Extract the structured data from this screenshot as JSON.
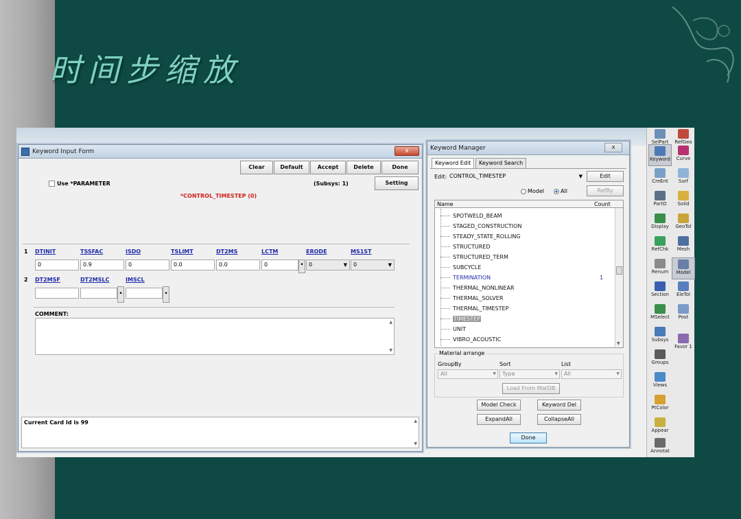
{
  "slide": {
    "title": "时间步缩放"
  },
  "keyword_input_form": {
    "title": "Keyword Input Form",
    "close_label": "x",
    "buttons": {
      "clear": "Clear",
      "default": "Default",
      "accept": "Accept",
      "delete": "Delete",
      "done": "Done",
      "setting": "Setting"
    },
    "use_parameter_label": "Use *PARAMETER",
    "subsys_label": "(Subsys: 1)",
    "keyword_heading": "*CONTROL_TIMESTEP  (0)",
    "card1": {
      "number": "1",
      "fields": [
        {
          "name": "DTINIT",
          "value": "0"
        },
        {
          "name": "TSSFAC",
          "value": "0.9"
        },
        {
          "name": "ISDO",
          "value": "0"
        },
        {
          "name": "TSLIMT",
          "value": "0.0"
        },
        {
          "name": "DT2MS",
          "value": "0.0"
        },
        {
          "name": "LCTM",
          "value": "0"
        },
        {
          "name": "ERODE",
          "value": "0"
        },
        {
          "name": "MS1ST",
          "value": "0"
        }
      ]
    },
    "card2": {
      "number": "2",
      "fields": [
        {
          "name": "DT2MSF",
          "value": ""
        },
        {
          "name": "DT2MSLC",
          "value": ""
        },
        {
          "name": "IMSCL",
          "value": ""
        }
      ]
    },
    "comment_label": "COMMENT:",
    "status_text": "Current Card Id is 99"
  },
  "keyword_manager": {
    "title": "Keyword Manager",
    "close_label": "x",
    "tabs": [
      "Keyword Edit",
      "Keyword Search"
    ],
    "edit_label": "Edit:",
    "edit_value": "CONTROL_TIMESTEP",
    "edit_button": "Edit",
    "refby_button": "RefBy",
    "radio_model": "Model",
    "radio_all": "All",
    "col_name": "Name",
    "col_count": "Count",
    "items": [
      {
        "name": "SPOTWELD_BEAM",
        "count": ""
      },
      {
        "name": "STAGED_CONSTRUCTION",
        "count": ""
      },
      {
        "name": "STEADY_STATE_ROLLING",
        "count": ""
      },
      {
        "name": "STRUCTURED",
        "count": ""
      },
      {
        "name": "STRUCTURED_TERM",
        "count": ""
      },
      {
        "name": "SUBCYCLE",
        "count": ""
      },
      {
        "name": "TERMINATION",
        "count": "1"
      },
      {
        "name": "THERMAL_NONLINEAR",
        "count": ""
      },
      {
        "name": "THERMAL_SOLVER",
        "count": ""
      },
      {
        "name": "THERMAL_TIMESTEP",
        "count": ""
      },
      {
        "name": "TIMESTEP",
        "count": ""
      },
      {
        "name": "UNIT",
        "count": ""
      },
      {
        "name": "VIBRO_ACOUSTIC",
        "count": ""
      }
    ],
    "material_arrange": "Material arrange",
    "groupby_label": "GroupBy",
    "sort_label": "Sort",
    "list_label": "List",
    "groupby_value": "All",
    "sort_value": "Type",
    "list_value": "All",
    "load_button": "Load From MatDB",
    "model_check": "Model Check",
    "keyword_del": "Keyword Del",
    "expand_all": "ExpandAll",
    "collapse_all": "CollapseAll",
    "done": "Done"
  },
  "toolbar": {
    "items": [
      {
        "label": "SelPart",
        "color": "#6d8fb8"
      },
      {
        "label": "RefGeo",
        "color": "#c04a3a"
      },
      {
        "label": "Keyword",
        "color": "#4d79b5"
      },
      {
        "label": "Curve",
        "color": "#b83070"
      },
      {
        "label": "CreEnt",
        "color": "#7aa0c8"
      },
      {
        "label": "Surf",
        "color": "#8fb3d9"
      },
      {
        "label": "PartD",
        "color": "#5c6f88"
      },
      {
        "label": "Solid",
        "color": "#d8b040"
      },
      {
        "label": "Display",
        "color": "#3a8f4a"
      },
      {
        "label": "GeoTol",
        "color": "#c9a43a"
      },
      {
        "label": "RefChk",
        "color": "#3aa05a"
      },
      {
        "label": "Mesh",
        "color": "#4f6fa0"
      },
      {
        "label": "Renum",
        "color": "#8a8a8a"
      },
      {
        "label": "Model",
        "color": "#6a7fa8"
      },
      {
        "label": "Section",
        "color": "#3a5fb0"
      },
      {
        "label": "EleTol",
        "color": "#5a7fc0"
      },
      {
        "label": "MSelect",
        "color": "#3a8f4a"
      },
      {
        "label": "Post",
        "color": "#7a9ac8"
      },
      {
        "label": "Subsys",
        "color": "#4a7ab8"
      },
      {
        "label": "Favor 1",
        "color": "#8a6ab0"
      },
      {
        "label": "Groups",
        "color": "#5a5a5a"
      },
      {
        "label": "Views",
        "color": "#4a8ac8"
      },
      {
        "label": "PtColor",
        "color": "#d8a030"
      },
      {
        "label": "Appear",
        "color": "#c8b040"
      },
      {
        "label": "Annotat",
        "color": "#6a6a6a"
      }
    ]
  }
}
